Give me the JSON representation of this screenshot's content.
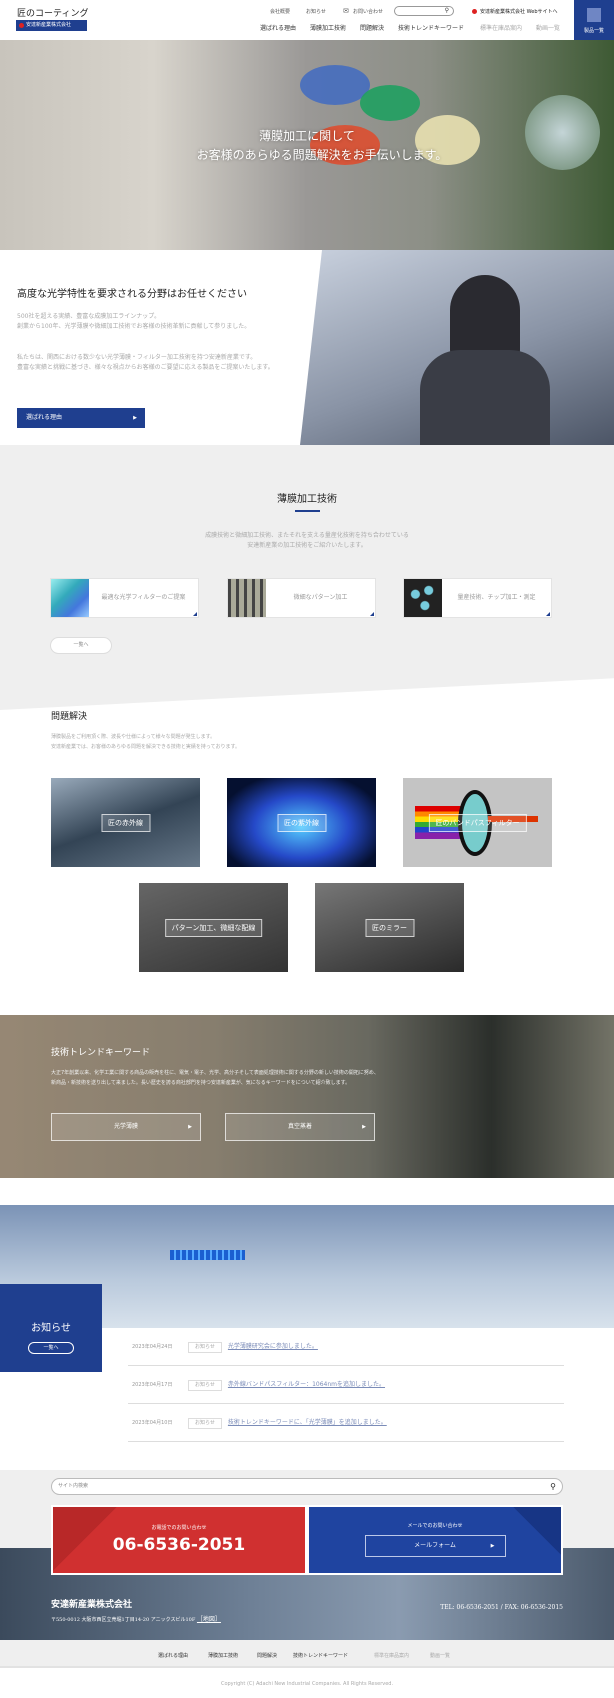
{
  "header": {
    "logo_title": "匠のコーティング",
    "logo_company": "安達新産業株式会社",
    "util_links": [
      "会社概要",
      "お知らせ",
      "お問い合わせ"
    ],
    "search_icon": "search-icon",
    "web_link": "安達新産業株式会社 Webサイトへ",
    "nav": [
      "選ばれる理由",
      "薄膜加工技術",
      "問題解決",
      "技術トレンドキーワード",
      "標準在庫品案内",
      "動画一覧"
    ],
    "product_button": "製品一覧"
  },
  "hero": {
    "line1": "薄膜加工に関して",
    "line2": "お客様のあらゆる問題解決をお手伝いします。"
  },
  "intro": {
    "title": "高度な光学特性を要求される分野はお任せください",
    "p1": [
      "500社を超える実績、豊富な成膜加工ラインナップ。",
      "創業から100年、光学薄膜や微細加工技術でお客様の技術革新に貢献して参りました。"
    ],
    "p2": [
      "私たちは、関西における数少ない光学薄膜・フィルター加工技術を持つ安達新産業です。",
      "豊富な実績と挑戦に基づき、様々な視点からお客様のご要望に応える製品をご提案いたします。"
    ],
    "button": "選ばれる理由"
  },
  "tech": {
    "title": "薄膜加工技術",
    "desc": [
      "成膜技術と微細加工技術、またそれを支える量産化技術を持ち合わせている",
      "安達新産業の加工技術をご紹介いたします。"
    ],
    "cards": [
      "最適な光学フィルターのご提案",
      "微細なパターン加工",
      "量産技術、チップ加工・測定"
    ],
    "more": "一覧へ"
  },
  "problem": {
    "title": "問題解決",
    "desc": [
      "薄膜製品をご利用頂く際、波長や仕様によって様々な問題が発生します。",
      "安達新産業では、お客様のあらゆる問題を解決できる技術と実績を持っております。"
    ],
    "tiles": [
      "匠の赤外線",
      "匠の紫外線",
      "匠のバンドパスフィルター",
      "パターン加工、微細な配線",
      "匠のミラー"
    ]
  },
  "trend": {
    "title": "技術トレンドキーワード",
    "desc": [
      "大正7年創業以来、化学工業に関する商品の販売を柱に、電気・電子、光学、高分子そして表面処理技術に関する分野の新しい技術の開拓に努め、",
      "新商品・新技術を送り出して来ました。長い歴史を誇る商社部門を持つ安達新産業が、気になるキーワードをについて紹介致します。"
    ],
    "buttons": [
      "光学薄膜",
      "真空蒸着"
    ]
  },
  "news": {
    "title": "お知らせ",
    "more": "一覧へ",
    "items": [
      {
        "date": "2023年04月24日",
        "tag": "お知らせ",
        "title": "光学薄膜研究会に参加しました。"
      },
      {
        "date": "2023年04月17日",
        "tag": "お知らせ",
        "title": "赤外線バンドパスフィルター：1064nmを追加しました。"
      },
      {
        "date": "2023年04月10日",
        "tag": "お知らせ",
        "title": "技術トレンドキーワードに、「光学薄膜」を追加しました。"
      }
    ]
  },
  "footer": {
    "search_placeholder": "サイト内検索",
    "phone_label": "お電話でのお問い合わせ",
    "phone": "06-6536-2051",
    "mail_label": "メールでのお問い合わせ",
    "mail_button": "メールフォーム",
    "company": "安達新産業株式会社",
    "address": "〒550-0012 大阪市西区立売堀1丁目14-20 アニックスビル10F",
    "map_link": "［地図］",
    "telfax": "TEL: 06-6536-2051 / FAX: 06-6536-2015",
    "nav": [
      "選ばれる理由",
      "薄膜加工技術",
      "問題解決",
      "技術トレンドキーワード",
      "標準在庫品案内",
      "動画一覧"
    ],
    "copyright": "Copyright (C) Adachi New Industrial Companies. All Rights Reserved."
  },
  "colors": {
    "brand_blue": "#1f3f8f",
    "phone_red": "#d03030"
  }
}
